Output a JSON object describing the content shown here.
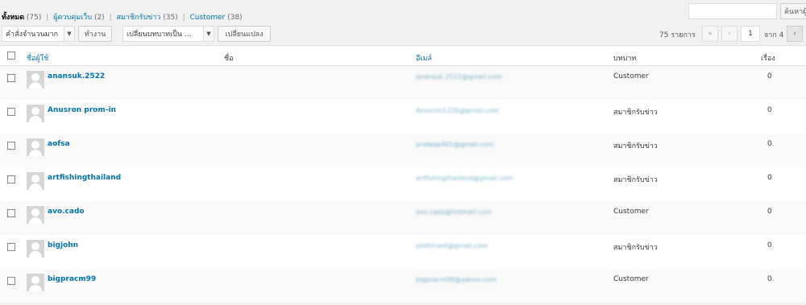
{
  "filters": {
    "all": {
      "label": "ทั้งหมด",
      "count": "(75)"
    },
    "admin": {
      "label": "ผู้ควบคุมเว็บ",
      "count": "(2)"
    },
    "subscriber": {
      "label": "สมาชิกรับข่าว",
      "count": "(35)"
    },
    "customer": {
      "label": "Customer",
      "count": "(38)"
    },
    "separator": "|"
  },
  "search": {
    "value": "",
    "button_label": "ค้นหาผู้ใช้"
  },
  "bulk_action": {
    "selected": "คำสั่งจำนวนมาก",
    "apply_label": "ทำงาน"
  },
  "change_role": {
    "selected": "เปลี่ยนบทบาทเป็น ...",
    "button_label": "เปลี่ยนแปลง"
  },
  "pagination": {
    "items": "75 รายการ",
    "first": "«",
    "prev": "‹",
    "current": "1",
    "total": "จาก 4",
    "next": "›"
  },
  "columns": {
    "username": "ชื่อผู้ใช้",
    "name": "ชื่อ",
    "email": "อีเมล์",
    "role": "บทบาท",
    "posts": "เรื่อง"
  },
  "users": [
    {
      "username": "anansuk.2522",
      "name": "",
      "email": "anansuk.2522@gmail.com",
      "role": "Customer",
      "posts": "0"
    },
    {
      "username": "Anusron prom-in",
      "name": "",
      "email": "Anusron1226@gmail.com",
      "role": "สมาชิกรับข่าว",
      "posts": "0"
    },
    {
      "username": "aofsa",
      "name": "",
      "email": "prateep401@gmail.com",
      "role": "สมาชิกรับข่าว",
      "posts": "0"
    },
    {
      "username": "artfishingthailand",
      "name": "",
      "email": "artfishingthailand@gmail.com",
      "role": "สมาชิกรับข่าว",
      "posts": "0"
    },
    {
      "username": "avo.cado",
      "name": "",
      "email": "avo.cado@hotmail.com",
      "role": "Customer",
      "posts": "0"
    },
    {
      "username": "bigjohn",
      "name": "",
      "email": "phittinant@gmail.com",
      "role": "สมาชิกรับข่าว",
      "posts": "0"
    },
    {
      "username": "bigpracm99",
      "name": "",
      "email": "bigpracm99@yahoo.com",
      "role": "Customer",
      "posts": "0"
    }
  ],
  "colors": {
    "link": "#0073aa",
    "text": "#32373c",
    "background": "#f1f1f1"
  }
}
